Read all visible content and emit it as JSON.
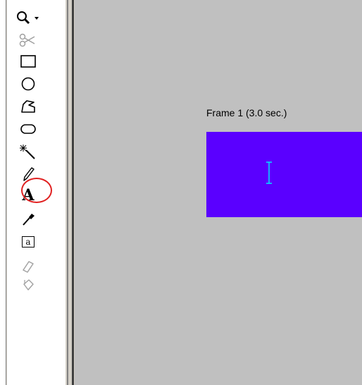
{
  "toolbar": {
    "tools": [
      {
        "name": "zoom-tool",
        "icon": "magnifier-icon",
        "has_dropdown": true,
        "enabled": true
      },
      {
        "name": "cut-tool",
        "icon": "scissors-icon",
        "enabled": false
      },
      {
        "name": "rectangle-tool",
        "icon": "rectangle-icon",
        "enabled": true
      },
      {
        "name": "ellipse-tool",
        "icon": "ellipse-icon",
        "enabled": true
      },
      {
        "name": "polygon-tool",
        "icon": "polygon-icon",
        "enabled": true
      },
      {
        "name": "rounded-rectangle-tool",
        "icon": "rounded-rectangle-icon",
        "enabled": true
      },
      {
        "name": "magic-wand-tool",
        "icon": "magic-wand-icon",
        "enabled": true
      },
      {
        "name": "pencil-tool",
        "icon": "pencil-icon",
        "enabled": true
      },
      {
        "name": "text-tool",
        "icon": "text-A-icon",
        "label": "A",
        "selected": true,
        "highlighted": true
      },
      {
        "name": "eyedropper-tool",
        "icon": "eyedropper-icon",
        "enabled": true
      },
      {
        "name": "text-object-tool",
        "icon": "text-box-icon",
        "label": "a",
        "enabled": true
      },
      {
        "name": "eraser-tool",
        "icon": "eraser-icon",
        "enabled": false
      },
      {
        "name": "paint-bucket-tool",
        "icon": "paint-bucket-icon",
        "enabled": false
      }
    ]
  },
  "canvas": {
    "frame_label": "Frame 1 (3.0 sec.)",
    "frame_color": "#5a00ff",
    "cursor_icon": "i-beam-cursor-icon",
    "cursor_color": "#00e5ff"
  },
  "colors": {
    "background": "#c0c0c0",
    "highlight_circle": "#e02020"
  }
}
